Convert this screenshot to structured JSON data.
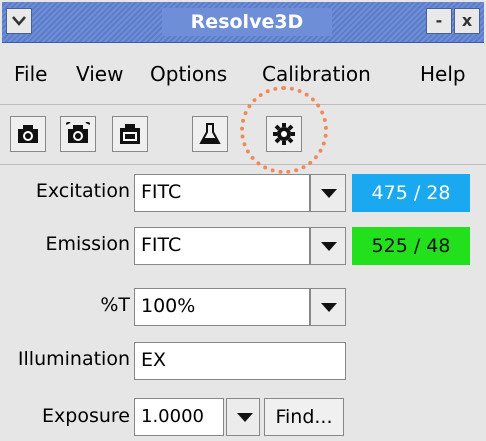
{
  "window": {
    "title": "Resolve3D",
    "titlebar_color": "#6f8ed8",
    "menu_icon": "chevron-down-icon",
    "minimize_label": "-",
    "close_label": "x"
  },
  "menu": {
    "file": "File",
    "view": "View",
    "options": "Options",
    "calibration": "Calibration",
    "help": "Help"
  },
  "toolbar": {
    "icons": [
      "camera-icon",
      "camera-sequence-icon",
      "camera-stack-icon",
      "flask-icon",
      "gear-icon"
    ],
    "annotation_color": "#f07a44"
  },
  "form": {
    "excitation": {
      "label": "Excitation",
      "value": "FITC",
      "badge": "475 / 28",
      "badge_color": "#1aa8f0"
    },
    "emission": {
      "label": "Emission",
      "value": "FITC",
      "badge": "525 / 48",
      "badge_color": "#22e01c"
    },
    "transmission": {
      "label": "%T",
      "value": "100%"
    },
    "illumination": {
      "label": "Illumination",
      "value": "EX"
    },
    "exposure": {
      "label": "Exposure",
      "value": "1.0000",
      "find_label": "Find..."
    }
  }
}
